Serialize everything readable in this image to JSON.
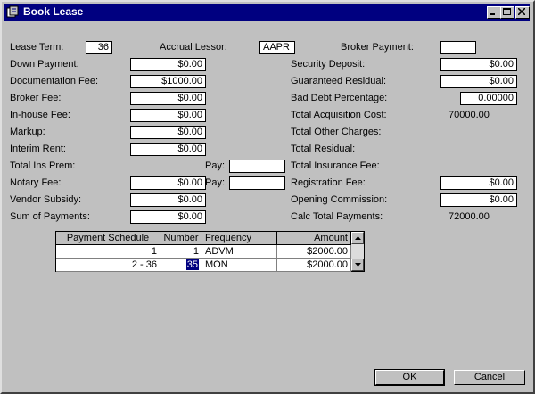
{
  "window": {
    "title": "Book Lease"
  },
  "left": {
    "lease_term": {
      "label": "Lease Term:",
      "value": "36"
    },
    "down_payment": {
      "label": "Down Payment:",
      "value": "$0.00"
    },
    "documentation_fee": {
      "label": "Documentation Fee:",
      "value": "$1000.00"
    },
    "broker_fee": {
      "label": "Broker Fee:",
      "value": "$0.00"
    },
    "inhouse_fee": {
      "label": "In-house Fee:",
      "value": "$0.00"
    },
    "markup": {
      "label": "Markup:",
      "value": "$0.00"
    },
    "interim_rent": {
      "label": "Interim Rent:",
      "value": "$0.00"
    },
    "total_ins_prem": {
      "label": "Total Ins Prem:"
    },
    "notary_fee": {
      "label": "Notary Fee:",
      "value": "$0.00"
    },
    "vendor_subsidy": {
      "label": "Vendor Subsidy:",
      "value": "$0.00"
    },
    "sum_of_payments": {
      "label": "Sum of Payments:",
      "value": "$0.00"
    }
  },
  "middle": {
    "accrual_lessor": {
      "label": "Accrual Lessor:",
      "value": "AAPR"
    },
    "pay1": {
      "label": "Pay:",
      "value": ""
    },
    "pay2": {
      "label": "Pay:",
      "value": ""
    }
  },
  "right": {
    "broker_payment": {
      "label": "Broker Payment:",
      "value": ""
    },
    "security_deposit": {
      "label": "Security Deposit:",
      "value": "$0.00"
    },
    "guaranteed_residual": {
      "label": "Guaranteed Residual:",
      "value": "$0.00"
    },
    "bad_debt_percentage": {
      "label": "Bad Debt Percentage:",
      "value": "0.00000"
    },
    "total_acquisition_cost": {
      "label": "Total Acquisition Cost:",
      "value": "70000.00"
    },
    "total_other_charges": {
      "label": "Total Other Charges:"
    },
    "total_residual": {
      "label": "Total Residual:"
    },
    "total_insurance_fee": {
      "label": "Total Insurance Fee:"
    },
    "registration_fee": {
      "label": "Registration Fee:",
      "value": "$0.00"
    },
    "opening_commission": {
      "label": "Opening Commission:",
      "value": "$0.00"
    },
    "calc_total_payments": {
      "label": "Calc Total Payments:",
      "value": "72000.00"
    }
  },
  "schedule": {
    "headers": {
      "payment_schedule": "Payment Schedule",
      "number": "Number",
      "frequency": "Frequency",
      "amount": "Amount"
    },
    "rows": [
      {
        "payment_schedule": "1",
        "number": "1",
        "frequency": "ADVM",
        "amount": "$2000.00"
      },
      {
        "payment_schedule": "2 -  36",
        "number": "35",
        "frequency": "MON",
        "amount": "$2000.00"
      }
    ]
  },
  "buttons": {
    "ok": "OK",
    "cancel": "Cancel"
  }
}
